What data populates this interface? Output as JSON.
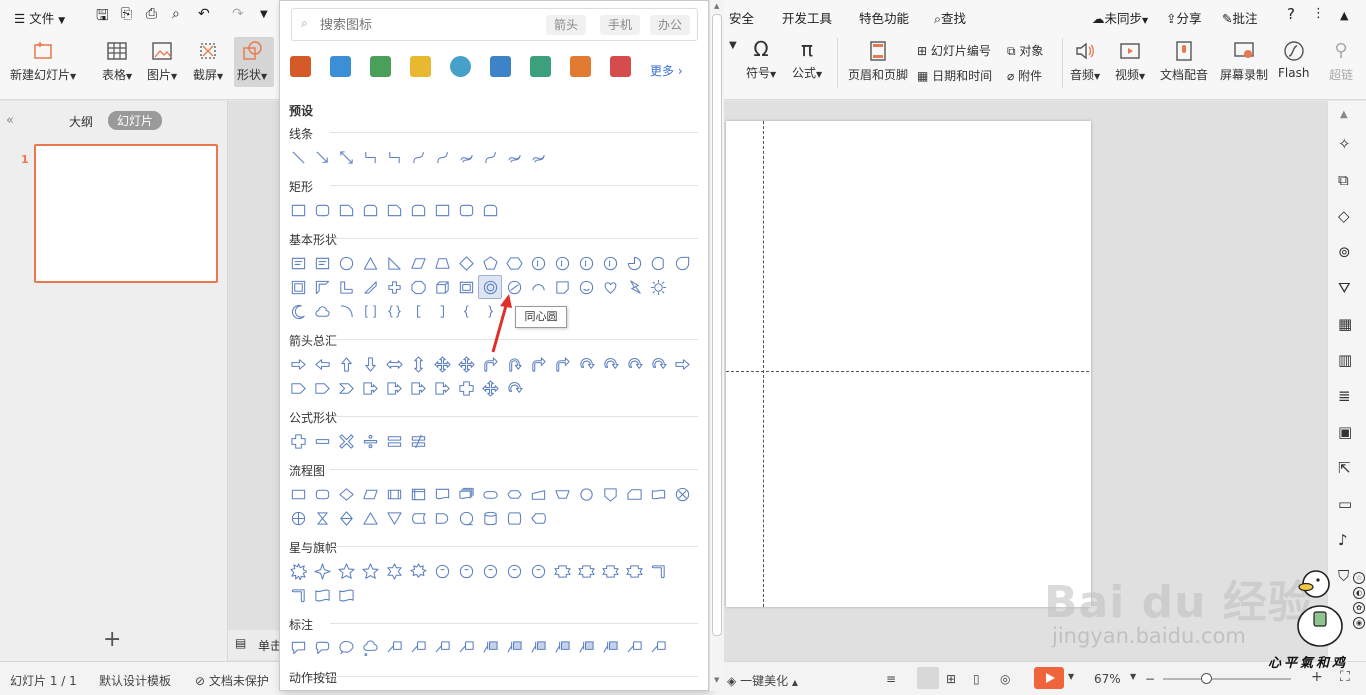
{
  "menu": {
    "file": "文件",
    "security": "安全",
    "developer_tools": "开发工具",
    "special_features": "特色功能",
    "find": "查找",
    "sync": "未同步",
    "share": "分享",
    "comment": "批注"
  },
  "toolbar": {
    "new_slide": "新建幻灯片",
    "table": "表格",
    "picture": "图片",
    "screenshot": "截屏",
    "shape": "形状",
    "symbol": "符号",
    "formula": "公式",
    "header_footer": "页眉和页脚",
    "slide_number": "幻灯片编号",
    "object": "对象",
    "date_time": "日期和时间",
    "attachment": "附件",
    "audio": "音频",
    "video": "视频",
    "narration": "文档配音",
    "screen_record": "屏幕录制",
    "flash": "Flash",
    "hyperlink": "超链"
  },
  "sidebar": {
    "tab_outline": "大纲",
    "tab_slides": "幻灯片",
    "slide_number": "1"
  },
  "shape_panel": {
    "search_placeholder": "搜索图标",
    "tags": [
      "箭头",
      "手机",
      "办公"
    ],
    "more": "更多",
    "preset": "预设",
    "sections": {
      "lines": "线条",
      "rectangles": "矩形",
      "basic_shapes": "基本形状",
      "block_arrows": "箭头总汇",
      "equation_shapes": "公式形状",
      "flowchart": "流程图",
      "stars_banners": "星与旗帜",
      "callouts": "标注",
      "action_buttons": "动作按钮"
    },
    "tooltip": "同心圆"
  },
  "notes_label": "单击",
  "status": {
    "slide_counter": "幻灯片 1 / 1",
    "theme": "默认设计模板",
    "doc_protect": "文档未保护",
    "beautify": "一键美化",
    "zoom": "67%"
  },
  "watermark": {
    "baidu": "Bai du 经验",
    "url": "jingyan.baidu.com",
    "slogan": "心平氣和鸡"
  },
  "colors": {
    "accent": "#e8784d",
    "shape_outline": "#5b7fbf",
    "play_button": "#f0643c",
    "selection_arrow": "#e0302a"
  }
}
